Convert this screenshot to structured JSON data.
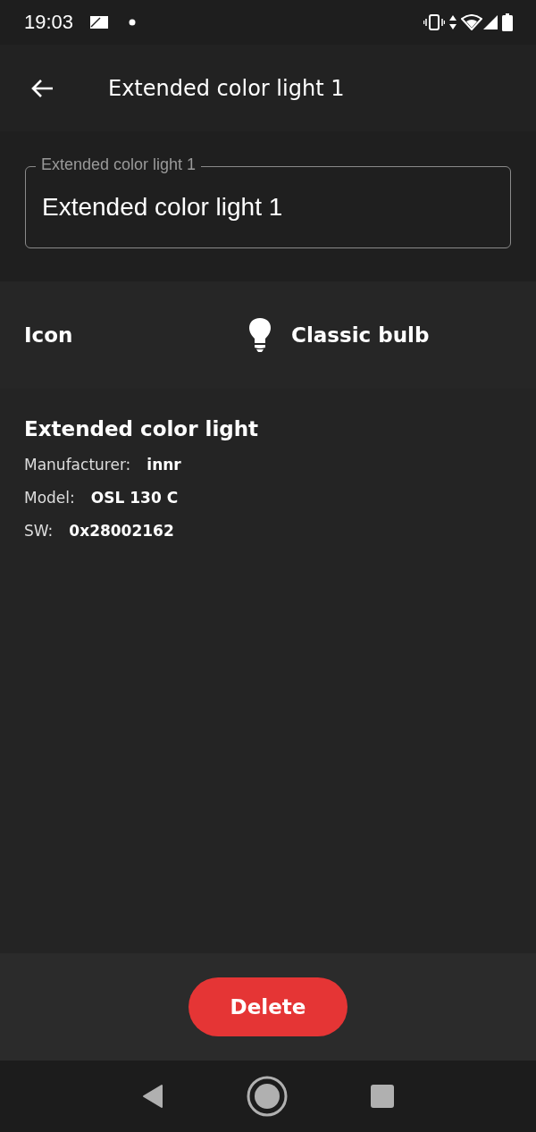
{
  "status_bar": {
    "time": "19:03"
  },
  "app_bar": {
    "title": "Extended color light 1"
  },
  "name_field": {
    "label": "Extended color light 1",
    "value": "Extended color light 1"
  },
  "icon_row": {
    "label": "Icon",
    "value": "Classic bulb"
  },
  "details": {
    "title": "Extended color light",
    "rows": [
      {
        "label": "Manufacturer:",
        "value": "innr"
      },
      {
        "label": "Model:",
        "value": "OSL 130 C"
      },
      {
        "label": "SW:",
        "value": "0x28002162"
      }
    ]
  },
  "delete_button": {
    "label": "Delete"
  }
}
